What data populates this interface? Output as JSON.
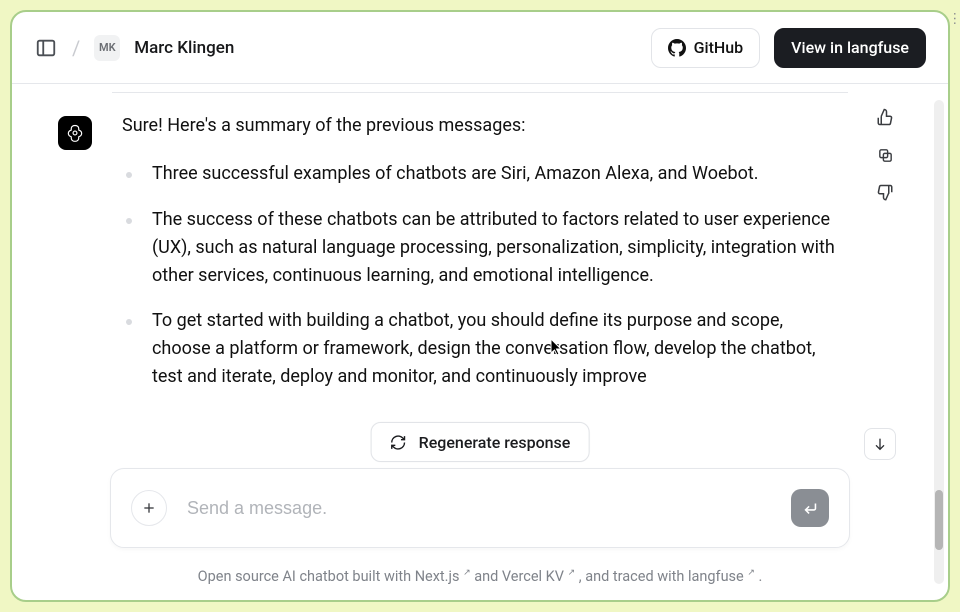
{
  "header": {
    "avatar_initials": "MK",
    "username": "Marc Klingen",
    "github_label": "GitHub",
    "view_langfuse_label": "View in langfuse"
  },
  "message": {
    "intro": "Sure! Here's a summary of the previous messages:",
    "bullets": [
      "Three successful examples of chatbots are Siri, Amazon Alexa, and Woebot.",
      "The success of these chatbots can be attributed to factors related to user experience (UX), such as natural language processing, personalization, simplicity, integration with other services, continuous learning, and emotional intelligence.",
      "To get started with building a chatbot, you should define its purpose and scope, choose a platform or framework, design the conversation flow, develop the chatbot, test and iterate, deploy and monitor, and continuously improve"
    ]
  },
  "controls": {
    "regenerate_label": "Regenerate response"
  },
  "input": {
    "placeholder": "Send a message."
  },
  "footer": {
    "p1": "Open source AI chatbot built with Next.js",
    "p2": " and Vercel KV",
    "p3": ", and traced with langfuse",
    "end": "."
  }
}
